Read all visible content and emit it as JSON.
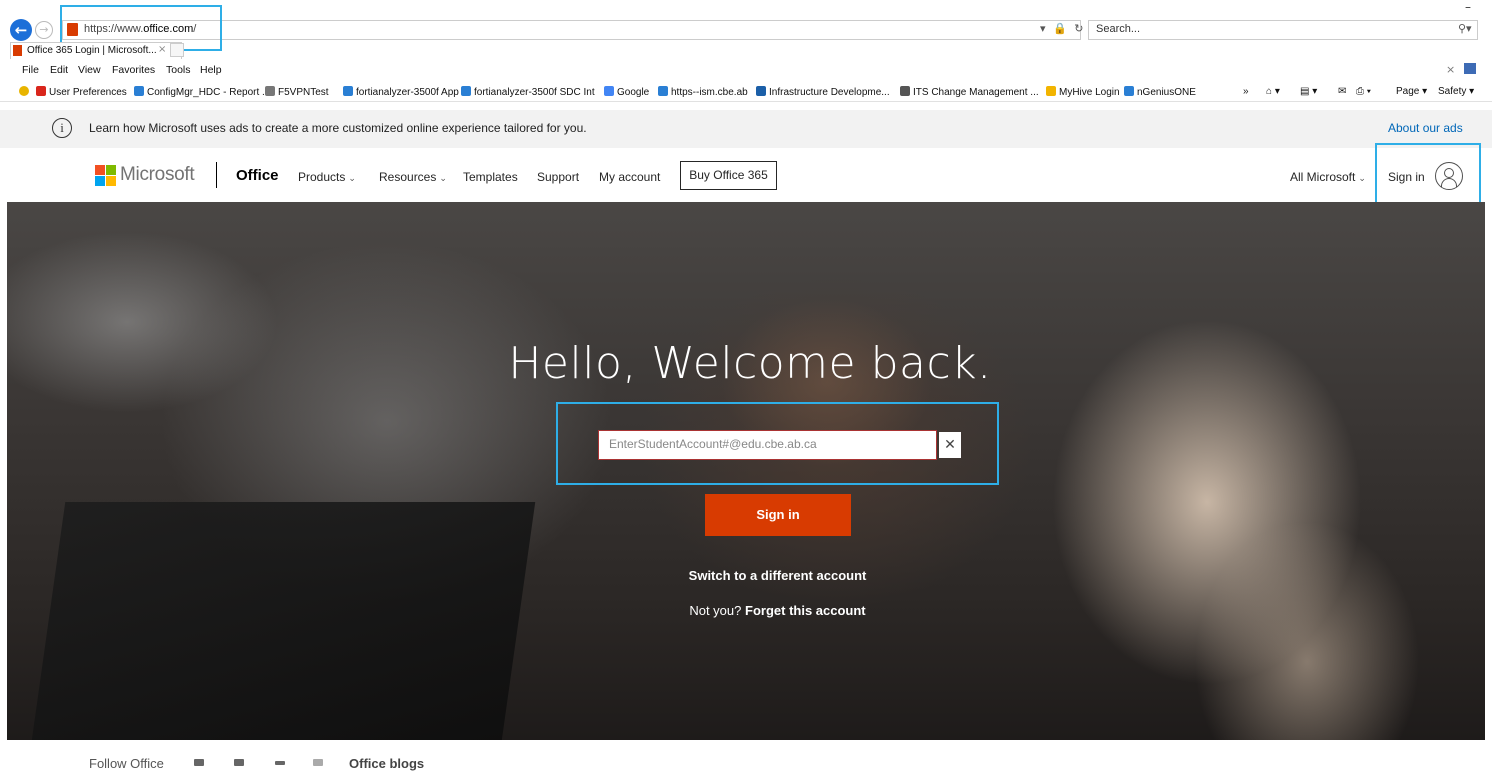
{
  "browser": {
    "url_prefix": "https://www.",
    "url_domain": "office.com",
    "url_suffix": "/",
    "search_placeholder": "Search...",
    "tab_title": "Office 365 Login | Microsoft...",
    "menu": [
      "File",
      "Edit",
      "View",
      "Favorites",
      "Tools",
      "Help"
    ],
    "favorites": [
      {
        "label": "User Preferences",
        "color": "#d9261c"
      },
      {
        "label": "ConfigMgr_HDC - Report ...",
        "color": "#2a7fd4"
      },
      {
        "label": "F5VPNTest",
        "color": "#777777"
      },
      {
        "label": "fortianalyzer-3500f App",
        "color": "#2a7fd4"
      },
      {
        "label": "fortianalyzer-3500f SDC Int",
        "color": "#2a7fd4"
      },
      {
        "label": "Google",
        "color": "#4285f4"
      },
      {
        "label": "https--ism.cbe.ab",
        "color": "#2a7fd4"
      },
      {
        "label": "Infrastructure Developme...",
        "color": "#1b5fa8"
      },
      {
        "label": "ITS Change Management ...",
        "color": "#555555"
      },
      {
        "label": "MyHive Login",
        "color": "#f2b400"
      },
      {
        "label": "nGeniusONE",
        "color": "#2a7fd4"
      }
    ],
    "command_bar": {
      "page": "Page ▾",
      "safety": "Safety ▾"
    }
  },
  "ads_banner": {
    "text": "Learn how Microsoft uses ads to create a more customized online experience tailored for you.",
    "link": "About our ads"
  },
  "header": {
    "brand": "Microsoft",
    "product": "Office",
    "nav": [
      {
        "label": "Products",
        "dropdown": true
      },
      {
        "label": "Resources",
        "dropdown": true
      },
      {
        "label": "Templates",
        "dropdown": false
      },
      {
        "label": "Support",
        "dropdown": false
      },
      {
        "label": "My account",
        "dropdown": false
      }
    ],
    "buy_button": "Buy Office 365",
    "all_microsoft": "All Microsoft",
    "sign_in": "Sign in"
  },
  "hero": {
    "title": "Hello, Welcome back.",
    "email_value": "EnterStudentAccount#@edu.cbe.ab.ca",
    "signin_button": "Sign in",
    "switch_account": "Switch to a different account",
    "not_you": "Not you?",
    "forget_account": "Forget this account"
  },
  "footer": {
    "follow": "Follow Office",
    "blogs": "Office blogs"
  },
  "colors": {
    "accent": "#d83b01",
    "link": "#0067b8",
    "highlight": "#2eaee7"
  }
}
